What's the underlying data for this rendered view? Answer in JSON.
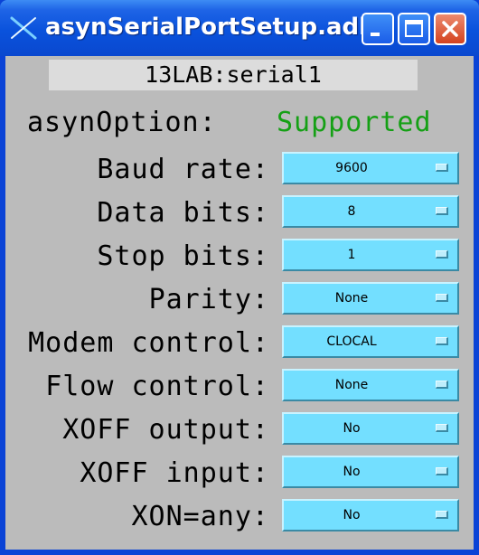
{
  "window": {
    "title": "asynSerialPortSetup.adl"
  },
  "port": {
    "name": "13LAB:serial1"
  },
  "asyn_option": {
    "label": "asynOption:",
    "value": "Supported"
  },
  "settings": [
    {
      "label": "Baud rate:",
      "value": "9600"
    },
    {
      "label": "Data bits:",
      "value": "8"
    },
    {
      "label": "Stop bits:",
      "value": "1"
    },
    {
      "label": "Parity:",
      "value": "None"
    },
    {
      "label": "Modem control:",
      "value": "CLOCAL"
    },
    {
      "label": "Flow control:",
      "value": "None"
    },
    {
      "label": "XOFF output:",
      "value": "No"
    },
    {
      "label": "XOFF input:",
      "value": "No"
    },
    {
      "label": "XON=any:",
      "value": "No"
    }
  ],
  "colors": {
    "titlebar": "#0a52dc",
    "client_background": "#bbbbbb",
    "menu_background": "#73dfff",
    "supported_text": "#15a015"
  },
  "icons": {
    "app": "x-cross-icon",
    "minimize": "minimize-icon",
    "maximize": "maximize-icon",
    "close": "close-icon"
  }
}
